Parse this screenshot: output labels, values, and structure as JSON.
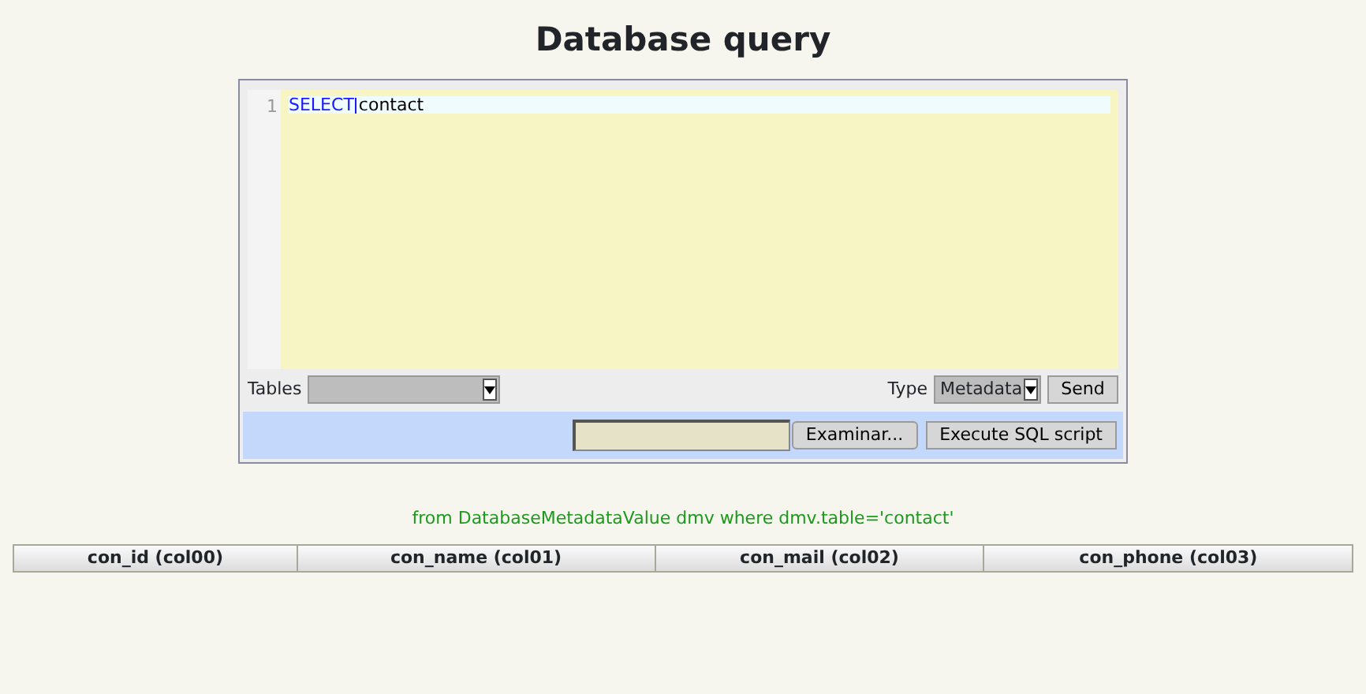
{
  "title": "Database query",
  "editor": {
    "lines": [
      {
        "number": "1",
        "tokens": [
          {
            "text": "SELECT",
            "kind": "keyword"
          },
          {
            "text": "contact",
            "kind": "plain"
          }
        ]
      }
    ]
  },
  "tables_label": "Tables",
  "type_label": "Type",
  "type_value": "Metadata",
  "send_button": "Send",
  "browse_button": "Examinar...",
  "execute_button": "Execute SQL script",
  "query_hint": "from DatabaseMetadataValue dmv where dmv.table='contact'",
  "table": {
    "columns": [
      "con_id (col00)",
      "con_name (col01)",
      "con_mail (col02)",
      "con_phone (col03)"
    ]
  }
}
